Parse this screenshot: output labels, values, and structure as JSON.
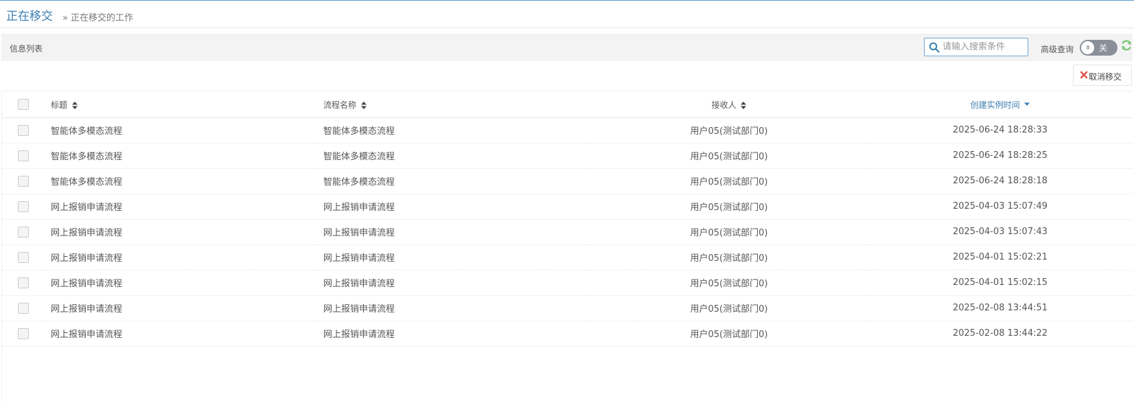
{
  "header": {
    "title": "正在移交",
    "breadcrumb_sep": "»",
    "breadcrumb": "正在移交的工作"
  },
  "list_bar": {
    "label": "信息列表",
    "search_placeholder": "请输入搜索条件",
    "advanced_label": "高级查询",
    "toggle_knob": "III",
    "toggle_text": "关"
  },
  "toolbar": {
    "cancel_label": "取消移交"
  },
  "colors": {
    "accent": "#3c7fb1",
    "refresh": "#7cc576",
    "cancel_x": "#e0574f"
  },
  "table": {
    "columns": [
      "标题",
      "流程名称",
      "接收人",
      "创建实例时间"
    ],
    "rows": [
      [
        "智能体多模态流程",
        "智能体多模态流程",
        "用户05(测试部门0)",
        "2025-06-24 18:28:33"
      ],
      [
        "智能体多模态流程",
        "智能体多模态流程",
        "用户05(测试部门0)",
        "2025-06-24 18:28:25"
      ],
      [
        "智能体多模态流程",
        "智能体多模态流程",
        "用户05(测试部门0)",
        "2025-06-24 18:28:18"
      ],
      [
        "网上报销申请流程",
        "网上报销申请流程",
        "用户05(测试部门0)",
        "2025-04-03 15:07:49"
      ],
      [
        "网上报销申请流程",
        "网上报销申请流程",
        "用户05(测试部门0)",
        "2025-04-03 15:07:43"
      ],
      [
        "网上报销申请流程",
        "网上报销申请流程",
        "用户05(测试部门0)",
        "2025-04-01 15:02:21"
      ],
      [
        "网上报销申请流程",
        "网上报销申请流程",
        "用户05(测试部门0)",
        "2025-04-01 15:02:15"
      ],
      [
        "网上报销申请流程",
        "网上报销申请流程",
        "用户05(测试部门0)",
        "2025-02-08 13:44:51"
      ],
      [
        "网上报销申请流程",
        "网上报销申请流程",
        "用户05(测试部门0)",
        "2025-02-08 13:44:22"
      ]
    ]
  }
}
